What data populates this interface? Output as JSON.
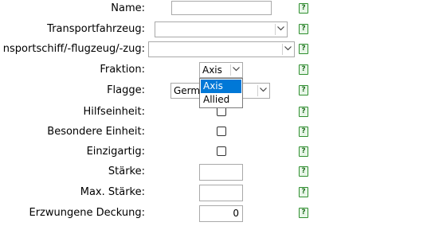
{
  "help_glyph": "?",
  "fields": {
    "name": {
      "label": "Name:",
      "value": ""
    },
    "transportfahrzeug": {
      "label": "Transportfahrzeug:",
      "value": ""
    },
    "transportschiff": {
      "label": "nsportschiff/-flugzeug/-zug:",
      "value": ""
    },
    "fraktion": {
      "label": "Fraktion:",
      "value": "Axis",
      "options": [
        "Axis",
        "Allied"
      ]
    },
    "flagge": {
      "label": "Flagge:",
      "value": "Germ"
    },
    "hilfseinheit": {
      "label": "Hilfseinheit:",
      "checked": false
    },
    "besondere_einheit": {
      "label": "Besondere Einheit:",
      "checked": false
    },
    "einzigartig": {
      "label": "Einzigartig:",
      "checked": false
    },
    "staerke": {
      "label": "Stärke:",
      "value": ""
    },
    "max_staerke": {
      "label": "Max. Stärke:",
      "value": ""
    },
    "erzwungene_deckung": {
      "label": "Erzwungene Deckung:",
      "value": "0"
    }
  },
  "colors": {
    "help_border": "#2f8f2f",
    "selection": "#0078d7"
  }
}
